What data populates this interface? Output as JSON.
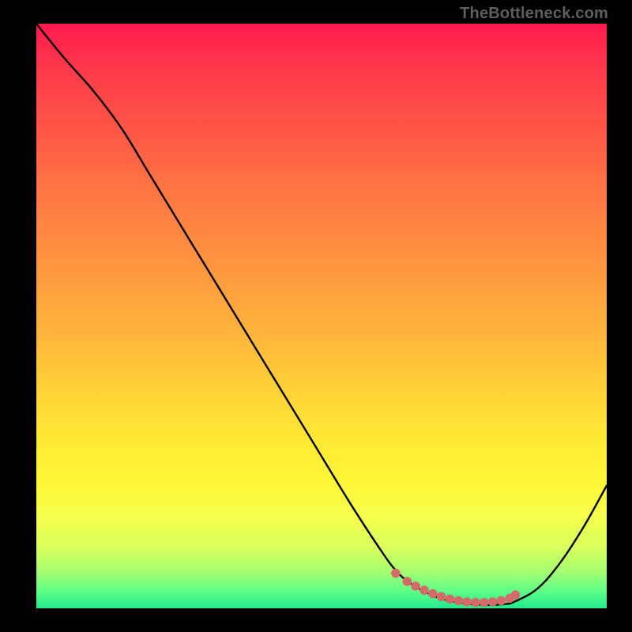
{
  "attribution": "TheBottleneck.com",
  "chart_data": {
    "type": "line",
    "title": "",
    "xlabel": "",
    "ylabel": "",
    "xlim": [
      0,
      100
    ],
    "ylim": [
      0,
      100
    ],
    "series": [
      {
        "name": "curve",
        "x": [
          0,
          5,
          10,
          15,
          20,
          25,
          30,
          35,
          40,
          45,
          50,
          55,
          60,
          63,
          66,
          70,
          74,
          78,
          82,
          84,
          88,
          92,
          96,
          100
        ],
        "y": [
          100,
          94,
          88.5,
          82,
          74,
          66,
          58,
          50,
          42,
          34,
          26,
          18,
          10.5,
          6.5,
          4,
          2,
          1,
          0.6,
          0.7,
          1.2,
          3.5,
          8,
          14,
          21
        ]
      }
    ],
    "markers": {
      "name": "highlight-dots",
      "color": "#d46b6b",
      "x": [
        63,
        65,
        66.5,
        68,
        69.5,
        71,
        72.5,
        74,
        75.5,
        77,
        78.5,
        80,
        81.5,
        83,
        84
      ],
      "y": [
        6.0,
        4.6,
        3.8,
        3.1,
        2.5,
        2.0,
        1.6,
        1.3,
        1.1,
        1.0,
        1.0,
        1.1,
        1.3,
        1.7,
        2.3
      ]
    },
    "gradient_colors": {
      "top": "#ff1a4d",
      "mid_upper": "#ff9240",
      "mid": "#ffe634",
      "mid_lower": "#d6ff60",
      "bottom": "#22eb8c"
    }
  }
}
